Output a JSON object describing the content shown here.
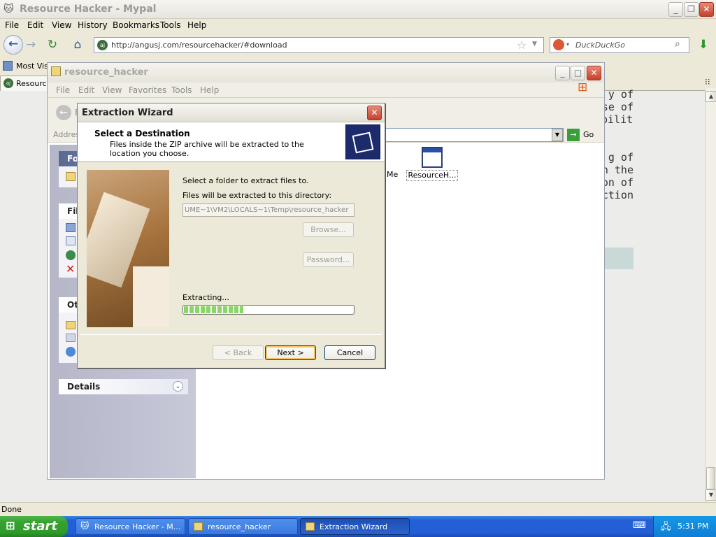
{
  "browser": {
    "title": "Resource Hacker - Mypal",
    "menu": [
      "File",
      "Edit",
      "View",
      "History",
      "Bookmarks",
      "Tools",
      "Help"
    ],
    "url": "http://angusj.com/resourcehacker/#download",
    "search_placeholder": "DuckDuckGo",
    "bookmark_label": "Most Visi",
    "tab_label": "Resource",
    "page_text": "y of\nse of\nbility\n\n\ng of\nn the\non of\nction",
    "status": "Done"
  },
  "explorer": {
    "title": "resource_hacker",
    "menu": [
      "File",
      "Edit",
      "View",
      "Favorites",
      "Tools",
      "Help"
    ],
    "back_label": "B",
    "address_label": "Addres",
    "go_label": "Go",
    "side_panels": {
      "folder_head": "Fol",
      "file_head": "File",
      "other_head": "Oth",
      "details_head": "Details"
    },
    "files": [
      {
        "label": "Me"
      },
      {
        "label": "ResourceH..."
      }
    ]
  },
  "wizard": {
    "title": "Extraction Wizard",
    "heading": "Select a Destination",
    "subheading": "Files inside the ZIP archive will be extracted to the location you choose.",
    "select_folder": "Select a folder to extract files to.",
    "extract_dir_label": "Files will be extracted to this directory:",
    "dir_value": "UME~1\\VM2\\LOCALS~1\\Temp\\resource_hacker",
    "browse_label": "Browse...",
    "password_label": "Password...",
    "extracting_label": "Extracting...",
    "progress": 0.35,
    "back_label": "< Back",
    "next_label": "Next >",
    "cancel_label": "Cancel"
  },
  "taskbar": {
    "start_label": "start",
    "tasks": [
      {
        "label": "Resource Hacker - M..."
      },
      {
        "label": "resource_hacker"
      },
      {
        "label": "Extraction Wizard"
      }
    ],
    "clock": "5:31 PM"
  }
}
